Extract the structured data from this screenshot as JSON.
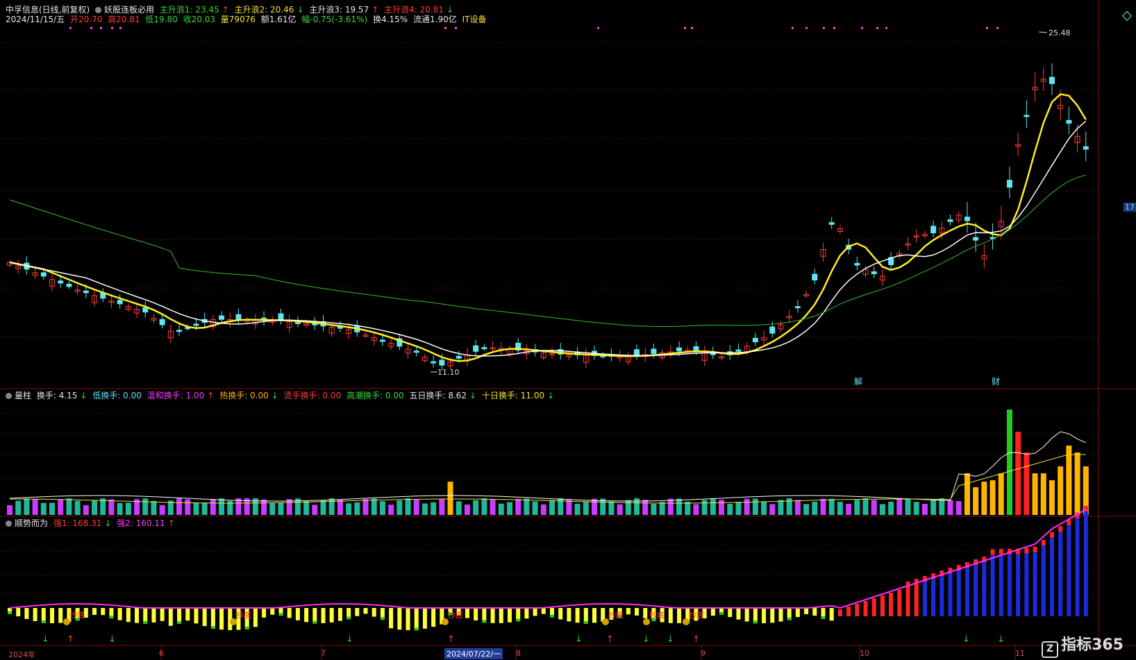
{
  "header": {
    "stock_name": "中孚信息(日线,前复权)",
    "indicator_name": "妖股连板必用",
    "wave1_label": "主升浪1: 23.45",
    "wave2_label": "主升浪2: 20.46",
    "wave3_label": "主升浪3: 19.57",
    "wave4_label": "主升浪4: 20.81",
    "date": "2024/11/15/五",
    "open": "开20.70",
    "high": "高20.81",
    "low": "低19.80",
    "close": "收20.03",
    "volume": "量79076",
    "amount": "额1.61亿",
    "change": "幅-0.75(-3.61%)",
    "turnover": "换4.15%",
    "float_cap": "流通1.90亿",
    "sector": "IT设备"
  },
  "panel2": {
    "name": "量柱",
    "turnover": "换手: 4.15",
    "low_turnover": "低换手: 0.00",
    "mild_turnover": "温和换手: 1.00",
    "hot_turnover": "热换手: 0.00",
    "burning_turnover": "烫手换手: 0.00",
    "climax_turnover": "高潮换手: 0.00",
    "five_day": "五日换手: 8.62",
    "ten_day": "十日换手: 11.00"
  },
  "panel3": {
    "name": "顺势而为",
    "strong1": "强1: 168.31",
    "strong2": "强2: 160.11",
    "bottom_label": "抄底"
  },
  "price_chart": {
    "max_label": "25.48",
    "min_label": "11.10",
    "events": [
      "解",
      "财"
    ]
  },
  "x_axis": {
    "labels": [
      "2024年",
      "6",
      "7",
      "8",
      "9",
      "10",
      "11"
    ],
    "cursor_date": "2024/07/22/一"
  },
  "right_axis": {
    "tag": "17"
  },
  "watermark": {
    "text": "指标365"
  },
  "colors": {
    "up": "#ff3b3b",
    "down": "#5ee6f2",
    "ma_yellow": "#ffee22",
    "ma_white": "#ffffff",
    "ma_green": "#2fbf2f",
    "vol_magenta": "#c83cff",
    "vol_teal": "#1fb89a",
    "vol_gold": "#ffb400",
    "vol_red": "#ff2020",
    "vol_green": "#22cc22",
    "bar_yellow": "#ffff33",
    "bar_red": "#ff2222",
    "bar_blue": "#1a2bdc",
    "line_magenta": "#ff2bff"
  }
}
